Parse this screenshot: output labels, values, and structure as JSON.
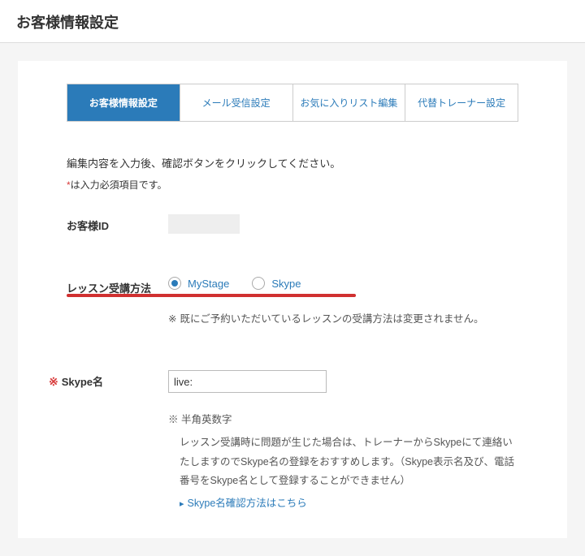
{
  "header": {
    "title": "お客様情報設定"
  },
  "tabs": [
    {
      "label": "お客様情報設定",
      "active": true
    },
    {
      "label": "メール受信設定",
      "active": false
    },
    {
      "label": "お気に入りリスト編集",
      "active": false
    },
    {
      "label": "代替トレーナー設定",
      "active": false
    }
  ],
  "instructions": {
    "line1": "編集内容を入力後、確認ボタンをクリックしてください。",
    "required_mark": "*",
    "required_text": "は入力必須項目です。"
  },
  "customer_id": {
    "label": "お客様ID",
    "value": ""
  },
  "lesson_method": {
    "label": "レッスン受講方法",
    "options": [
      {
        "label": "MyStage",
        "checked": true
      },
      {
        "label": "Skype",
        "checked": false
      }
    ],
    "note_mark": "※",
    "note": "既にご予約いただいているレッスンの受講方法は変更されません。"
  },
  "skype": {
    "marker": "※",
    "label": "Skype名",
    "value": "live:",
    "note_mark": "※",
    "format_note": "半角英数字",
    "desc": "レッスン受講時に問題が生じた場合は、トレーナーからSkypeにて連絡いたしますのでSkype名の登録をおすすめします。（Skype表示名及び、電話番号をSkype名として登録することができません）",
    "link_caret": "▸",
    "link_text": "Skype名確認方法はこちら"
  }
}
